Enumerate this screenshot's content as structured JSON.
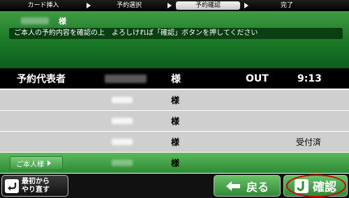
{
  "steps": [
    "カード挿入",
    "予約選択",
    "予約確認",
    "完了"
  ],
  "active_step": 2,
  "header": {
    "user_name": "■■ ■■",
    "honorific": "様",
    "instruction": "ご本人の予約内容を確認の上　よろしければ「確認」ボタンを押してください"
  },
  "table": {
    "header": {
      "label": "予約代表者",
      "name": "■■ ■■",
      "honorific": "様",
      "status": "OUT",
      "time": "9:13"
    },
    "rows": [
      {
        "name": "■■",
        "honorific": "様",
        "status": ""
      },
      {
        "name": "■■",
        "honorific": "様",
        "status": ""
      },
      {
        "name": "■■",
        "honorific": "様",
        "status": "受付済"
      },
      {
        "name": "■■",
        "honorific": "様",
        "status": "",
        "badge": "ご本人様"
      }
    ]
  },
  "footer": {
    "restart_label": "最初から\nやり直す",
    "back_label": "戻る",
    "confirm_label": "確認"
  }
}
